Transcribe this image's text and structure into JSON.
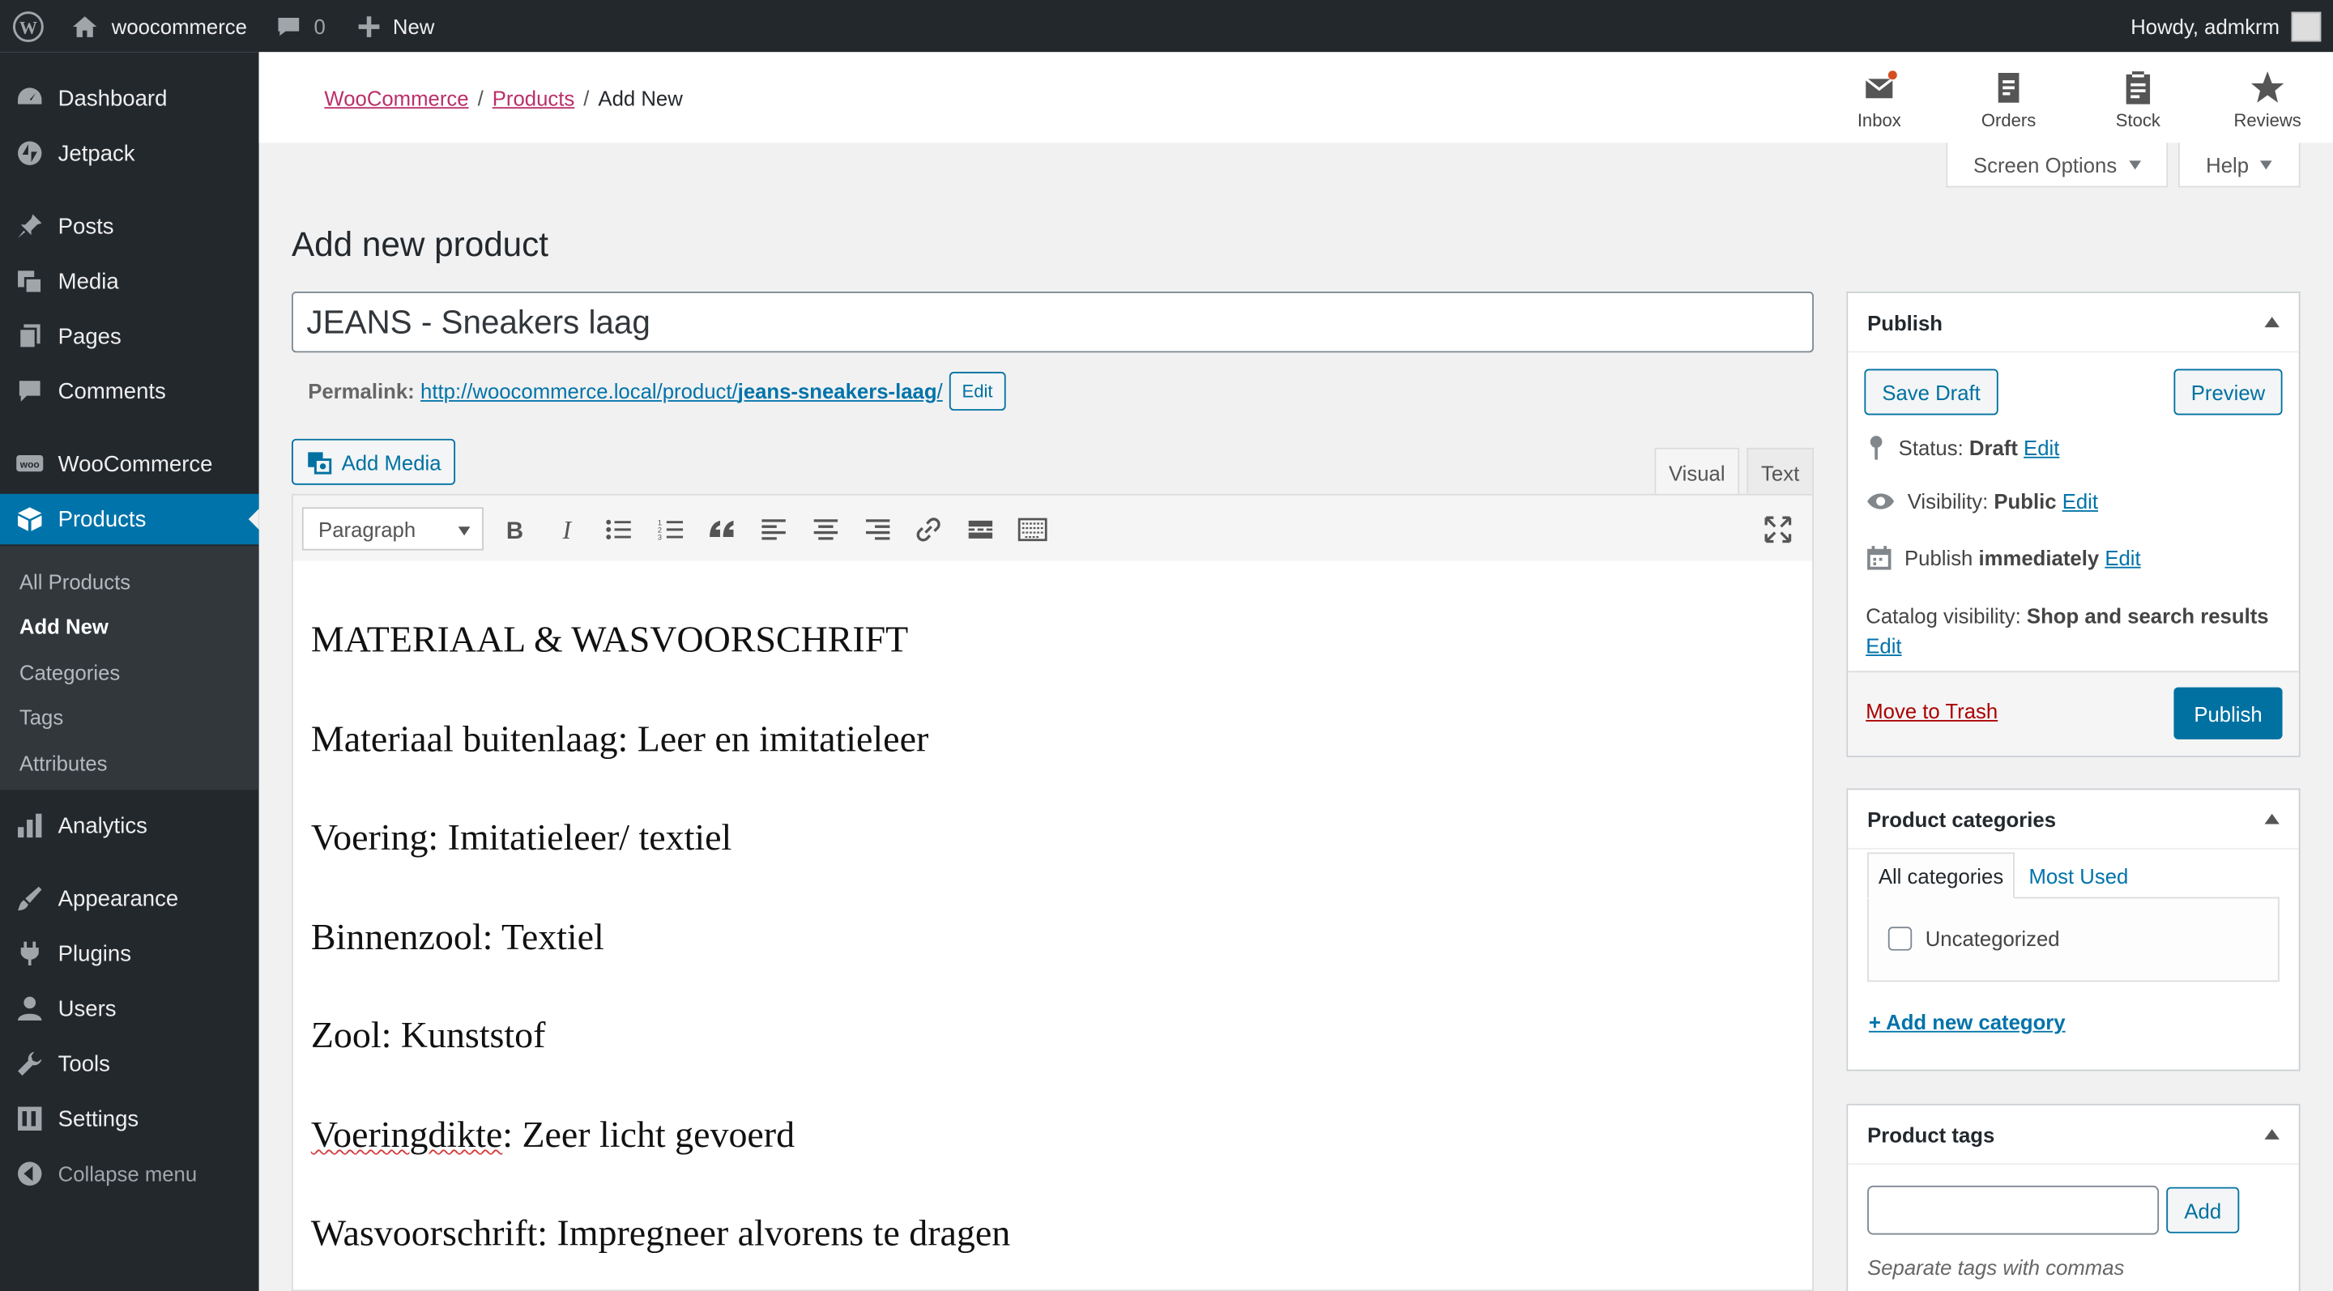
{
  "admin_bar": {
    "site_name": "woocommerce",
    "comments_count": "0",
    "new_label": "New",
    "howdy": "Howdy, admkrm"
  },
  "sidebar": {
    "items": [
      {
        "label": "Dashboard",
        "icon": "dashboard-icon"
      },
      {
        "label": "Jetpack",
        "icon": "jetpack-icon"
      },
      {
        "label": "Posts",
        "icon": "pin-icon"
      },
      {
        "label": "Media",
        "icon": "media-icon"
      },
      {
        "label": "Pages",
        "icon": "pages-icon"
      },
      {
        "label": "Comments",
        "icon": "comment-icon"
      },
      {
        "label": "WooCommerce",
        "icon": "woo-icon"
      },
      {
        "label": "Products",
        "icon": "products-icon",
        "active": true
      },
      {
        "label": "Analytics",
        "icon": "analytics-icon"
      },
      {
        "label": "Appearance",
        "icon": "brush-icon"
      },
      {
        "label": "Plugins",
        "icon": "plug-icon"
      },
      {
        "label": "Users",
        "icon": "user-icon"
      },
      {
        "label": "Tools",
        "icon": "wrench-icon"
      },
      {
        "label": "Settings",
        "icon": "settings-icon"
      },
      {
        "label": "Collapse menu",
        "icon": "collapse-icon"
      }
    ],
    "submenu": [
      "All Products",
      "Add New",
      "Categories",
      "Tags",
      "Attributes"
    ]
  },
  "header": {
    "breadcrumb": {
      "woocommerce": "WooCommerce",
      "products": "Products",
      "current": "Add New",
      "sep": "/"
    },
    "activity": {
      "inbox": "Inbox",
      "orders": "Orders",
      "stock": "Stock",
      "reviews": "Reviews"
    },
    "screen_options": "Screen Options",
    "help": "Help"
  },
  "page_title": "Add new product",
  "product_title": "JEANS - Sneakers laag",
  "permalink": {
    "label": "Permalink:",
    "base": "http://woocommerce.local/product/",
    "slug": "jeans-sneakers-laag",
    "trail": "/",
    "edit": "Edit"
  },
  "editor": {
    "add_media": "Add Media",
    "tab_visual": "Visual",
    "tab_text": "Text",
    "format": "Paragraph",
    "paragraphs": {
      "p1": "MATERIAAL & WASVOORSCHRIFT",
      "p2": "Materiaal buitenlaag: Leer en imitatieleer",
      "p3": "Voering: Imitatieleer/ textiel",
      "p4": "Binnenzool: Textiel",
      "p5": "Zool: Kunststof",
      "p6a": "Voeringdikte",
      "p6b": ": Zeer licht gevoerd",
      "p7": "Wasvoorschrift: Impregneer alvorens te dragen"
    }
  },
  "publish": {
    "title": "Publish",
    "save_draft": "Save Draft",
    "preview": "Preview",
    "status_label": "Status:",
    "status_value": "Draft",
    "visibility_label": "Visibility:",
    "visibility_value": "Public",
    "publish_label": "Publish",
    "publish_value": "immediately",
    "catalog_label": "Catalog visibility:",
    "catalog_value": "Shop and search results",
    "edit": "Edit",
    "trash": "Move to Trash",
    "publish_button": "Publish"
  },
  "categories": {
    "title": "Product categories",
    "tab_all": "All categories",
    "tab_used": "Most Used",
    "items": [
      "Uncategorized"
    ],
    "add_new": "+ Add new category"
  },
  "tags": {
    "title": "Product tags",
    "add": "Add",
    "hint": "Separate tags with commas",
    "input_value": ""
  }
}
